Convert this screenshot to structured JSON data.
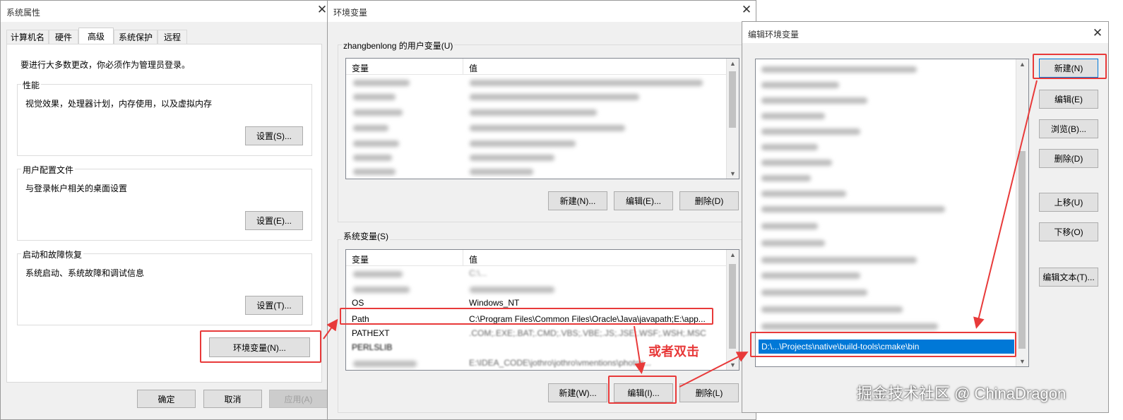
{
  "sys_props": {
    "title": "系统属性",
    "tabs": [
      "计算机名",
      "硬件",
      "高级",
      "系统保护",
      "远程"
    ],
    "admin_note": "要进行大多数更改，你必须作为管理员登录。",
    "performance": {
      "label": "性能",
      "desc": "视觉效果，处理器计划，内存使用，以及虚拟内存",
      "button": "设置(S)..."
    },
    "user_profile": {
      "label": "用户配置文件",
      "desc": "与登录帐户相关的桌面设置",
      "button": "设置(E)..."
    },
    "startup": {
      "label": "启动和故障恢复",
      "desc": "系统启动、系统故障和调试信息",
      "button": "设置(T)..."
    },
    "env_button": "环境变量(N)...",
    "ok": "确定",
    "cancel": "取消",
    "apply": "应用(A)"
  },
  "env_vars": {
    "title": "环境变量",
    "user_group": "zhangbenlong 的用户变量(U)",
    "col_var": "变量",
    "col_val": "值",
    "user_buttons": {
      "new": "新建(N)...",
      "edit": "编辑(E)...",
      "delete": "删除(D)"
    },
    "sys_group": "系统变量(S)",
    "sys_rows": [
      {
        "var": "",
        "val": "C:\\..."
      },
      {
        "var": "",
        "val": ""
      },
      {
        "var": "OS",
        "val": "Windows_NT"
      },
      {
        "var": "Path",
        "val": "C:\\Program Files\\Common Files\\Oracle\\Java\\javapath;E:\\app..."
      },
      {
        "var": "PATHEXT",
        "val": ".COM;.EXE;.BAT;.CMD;.VBS;.VBE;.JS;.JSE;.WSF;.WSH;.MSC"
      },
      {
        "var": "PERLSLIB",
        "val": ""
      },
      {
        "var": "",
        "val": "E:\\IDEA_CODE\\jothro\\jothro\\vmentions\\photos..."
      }
    ],
    "sys_buttons": {
      "new": "新建(W)...",
      "edit": "编辑(I)...",
      "delete": "删除(L)"
    }
  },
  "edit_env": {
    "title": "编辑环境变量",
    "selected_entry": "D:\\...\\Projects\\native\\build-tools\\cmake\\bin",
    "buttons": {
      "new": "新建(N)",
      "edit": "编辑(E)",
      "browse": "浏览(B)...",
      "delete": "删除(D)",
      "up": "上移(U)",
      "down": "下移(O)",
      "edit_text": "编辑文本(T)..."
    }
  },
  "annotation": {
    "double_click": "或者双击"
  },
  "watermark": "掘金技术社区 @ ChinaDragon",
  "colors": {
    "annotation_red": "#e83a3a",
    "selection_blue": "#0078d7"
  }
}
